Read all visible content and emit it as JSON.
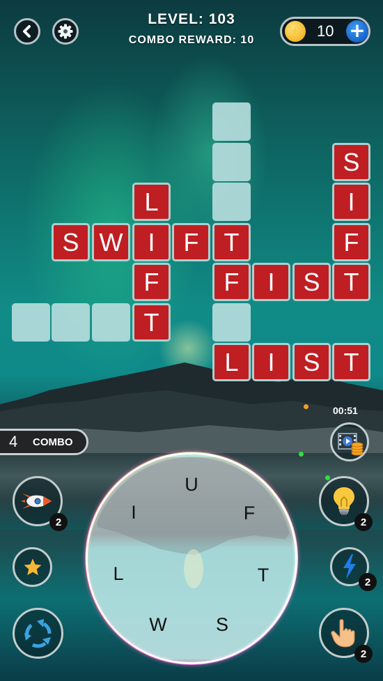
{
  "header": {
    "back_icon": "chevron-left-icon",
    "settings_icon": "gear-icon",
    "level_label": "LEVEL: 103",
    "combo_reward_label": "COMBO REWARD: 10",
    "coins": "10",
    "coin_icon": "star-coin-icon",
    "add_coins_icon": "plus-icon"
  },
  "board": {
    "tiles": [
      {
        "row": 0,
        "col": 5,
        "letter": ""
      },
      {
        "row": 1,
        "col": 5,
        "letter": ""
      },
      {
        "row": 1,
        "col": 8,
        "letter": "S"
      },
      {
        "row": 2,
        "col": 3,
        "letter": "L"
      },
      {
        "row": 2,
        "col": 5,
        "letter": ""
      },
      {
        "row": 2,
        "col": 8,
        "letter": "I"
      },
      {
        "row": 3,
        "col": 1,
        "letter": "S"
      },
      {
        "row": 3,
        "col": 2,
        "letter": "W"
      },
      {
        "row": 3,
        "col": 3,
        "letter": "I"
      },
      {
        "row": 3,
        "col": 4,
        "letter": "F"
      },
      {
        "row": 3,
        "col": 5,
        "letter": "T"
      },
      {
        "row": 3,
        "col": 8,
        "letter": "F"
      },
      {
        "row": 4,
        "col": 3,
        "letter": "F"
      },
      {
        "row": 4,
        "col": 5,
        "letter": "F"
      },
      {
        "row": 4,
        "col": 6,
        "letter": "I"
      },
      {
        "row": 4,
        "col": 7,
        "letter": "S"
      },
      {
        "row": 4,
        "col": 8,
        "letter": "T"
      },
      {
        "row": 5,
        "col": 0,
        "letter": ""
      },
      {
        "row": 5,
        "col": 1,
        "letter": ""
      },
      {
        "row": 5,
        "col": 2,
        "letter": ""
      },
      {
        "row": 5,
        "col": 3,
        "letter": "T"
      },
      {
        "row": 5,
        "col": 5,
        "letter": ""
      },
      {
        "row": 6,
        "col": 5,
        "letter": "L"
      },
      {
        "row": 6,
        "col": 6,
        "letter": "I"
      },
      {
        "row": 6,
        "col": 7,
        "letter": "S"
      },
      {
        "row": 6,
        "col": 8,
        "letter": "T"
      }
    ],
    "found_words": [
      "SWIFT",
      "LIFT",
      "SIFT",
      "FIST",
      "LIST"
    ]
  },
  "combo": {
    "count": "4",
    "label": "COMBO"
  },
  "timer": "00:51",
  "tools": {
    "rocket": {
      "icon": "rocket-icon",
      "count": "2"
    },
    "star": {
      "icon": "star-icon"
    },
    "shuffle": {
      "icon": "shuffle-icon"
    },
    "video_reward": {
      "icon": "video-coins-icon"
    },
    "hint": {
      "icon": "lightbulb-icon",
      "count": "2"
    },
    "lightning": {
      "icon": "lightning-icon",
      "count": "2"
    },
    "finger": {
      "icon": "pointing-hand-icon",
      "count": "2"
    }
  },
  "wheel": {
    "letters": [
      "U",
      "F",
      "T",
      "S",
      "W",
      "L",
      "I"
    ]
  },
  "colors": {
    "tile_filled": "#bf1e22",
    "tile_empty": "#b5dcdc",
    "tile_border": "#a9d0d0",
    "plus_button": "#1561c8",
    "coin": "#f2b827"
  }
}
